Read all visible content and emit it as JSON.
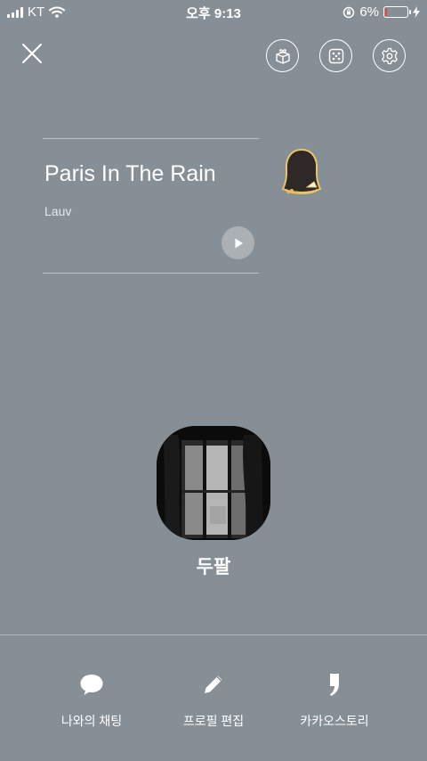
{
  "status_bar": {
    "carrier": "KT",
    "time": "오후 9:13",
    "battery_percent": "6%",
    "battery_level": 0.06
  },
  "top_bar": {
    "icons": [
      "close-icon",
      "gift-box-icon",
      "dice-icon",
      "gear-icon"
    ]
  },
  "music": {
    "title": "Paris In The Rain",
    "artist": "Lauv"
  },
  "profile": {
    "name": "두팔"
  },
  "bottom_menu": {
    "items": [
      {
        "label": "나와의 채팅",
        "icon": "chat-bubble-icon"
      },
      {
        "label": "프로필 편집",
        "icon": "pencil-icon"
      },
      {
        "label": "카카오스토리",
        "icon": "comma-icon"
      }
    ]
  },
  "colors": {
    "background": "#878f96",
    "battery_low": "#ff3b30"
  }
}
